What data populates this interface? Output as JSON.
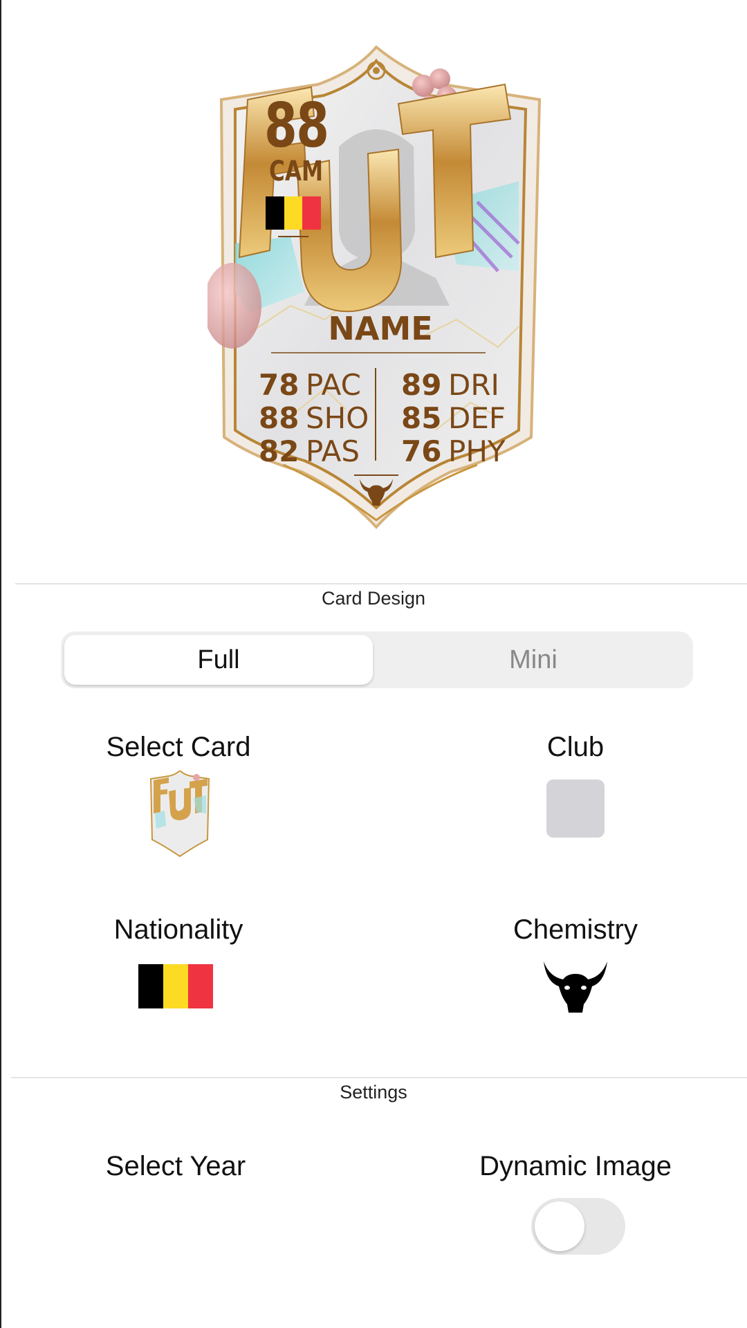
{
  "card": {
    "rating": "88",
    "position": "CAM",
    "name": "NAME",
    "stats_left": [
      {
        "value": "78",
        "label": "PAC"
      },
      {
        "value": "88",
        "label": "SHO"
      },
      {
        "value": "82",
        "label": "PAS"
      }
    ],
    "stats_right": [
      {
        "value": "89",
        "label": "DRI"
      },
      {
        "value": "85",
        "label": "DEF"
      },
      {
        "value": "76",
        "label": "PHY"
      }
    ],
    "design_text": "FUT",
    "text_color": "#7a4716",
    "chemistry_icon": "bull-head-icon",
    "flag_colors": [
      "#000000",
      "#FDDA24",
      "#EF3340"
    ]
  },
  "card_design": {
    "title": "Card Design",
    "options": [
      "Full",
      "Mini"
    ],
    "selected": "Full"
  },
  "select_card": {
    "label": "Select Card"
  },
  "club": {
    "label": "Club"
  },
  "nationality": {
    "label": "Nationality"
  },
  "chemistry": {
    "label": "Chemistry"
  },
  "settings": {
    "title": "Settings",
    "select_year_label": "Select Year",
    "dynamic_image_label": "Dynamic Image",
    "dynamic_image_on": false
  }
}
